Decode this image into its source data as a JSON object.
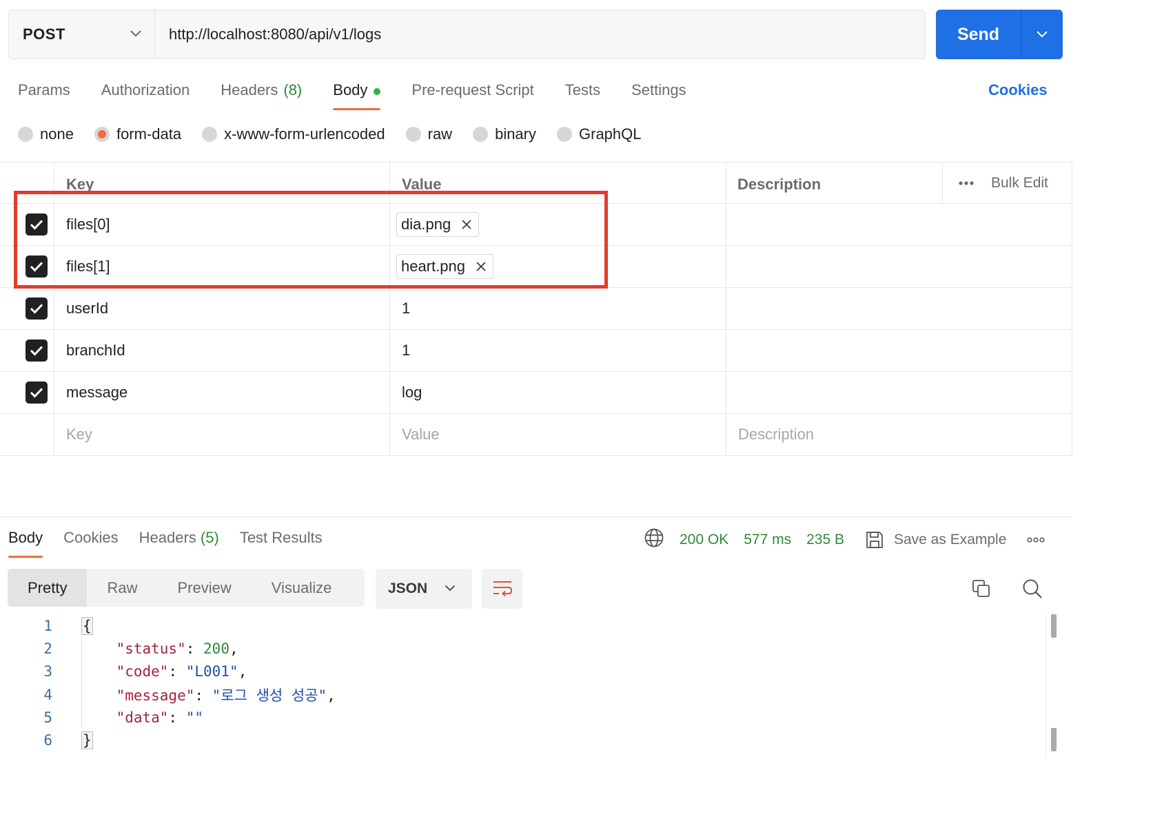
{
  "request": {
    "method": "POST",
    "url": "http://localhost:8080/api/v1/logs",
    "send_label": "Send"
  },
  "tabs": [
    {
      "label": "Params"
    },
    {
      "label": "Authorization"
    },
    {
      "label": "Headers",
      "count": "(8)"
    },
    {
      "label": "Body",
      "active": true,
      "has_dot": true
    },
    {
      "label": "Pre-request Script"
    },
    {
      "label": "Tests"
    },
    {
      "label": "Settings"
    }
  ],
  "cookies_link": "Cookies",
  "body_types": [
    {
      "label": "none"
    },
    {
      "label": "form-data",
      "selected": true
    },
    {
      "label": "x-www-form-urlencoded"
    },
    {
      "label": "raw"
    },
    {
      "label": "binary"
    },
    {
      "label": "GraphQL"
    }
  ],
  "table": {
    "headers": {
      "key": "Key",
      "value": "Value",
      "description": "Description",
      "bulk_edit": "Bulk Edit"
    },
    "rows": [
      {
        "key": "files[0]",
        "value": "dia.png",
        "type": "file",
        "checked": true
      },
      {
        "key": "files[1]",
        "value": "heart.png",
        "type": "file",
        "checked": true
      },
      {
        "key": "userId",
        "value": "1",
        "type": "text",
        "checked": true
      },
      {
        "key": "branchId",
        "value": "1",
        "type": "text",
        "checked": true
      },
      {
        "key": "message",
        "value": "log",
        "type": "text",
        "checked": true
      }
    ],
    "placeholders": {
      "key": "Key",
      "value": "Value",
      "description": "Description"
    }
  },
  "response": {
    "tabs": [
      {
        "label": "Body",
        "active": true
      },
      {
        "label": "Cookies"
      },
      {
        "label": "Headers",
        "count": "(5)"
      },
      {
        "label": "Test Results"
      }
    ],
    "status": "200 OK",
    "time": "577 ms",
    "size": "235 B",
    "save_label": "Save as Example",
    "view_modes": [
      "Pretty",
      "Raw",
      "Preview",
      "Visualize"
    ],
    "format": "JSON",
    "line_numbers": [
      "1",
      "2",
      "3",
      "4",
      "5",
      "6"
    ],
    "json": {
      "status_key": "\"status\"",
      "status_val": "200",
      "code_key": "\"code\"",
      "code_val": "\"L001\"",
      "message_key": "\"message\"",
      "message_val": "\"로그 생성 성공\"",
      "data_key": "\"data\"",
      "data_val": "\"\""
    }
  },
  "colors": {
    "accent_orange": "#f26b3a",
    "send_blue": "#1f6fe5",
    "success_green": "#2f8a3b",
    "highlight_red": "#e53b2c"
  }
}
